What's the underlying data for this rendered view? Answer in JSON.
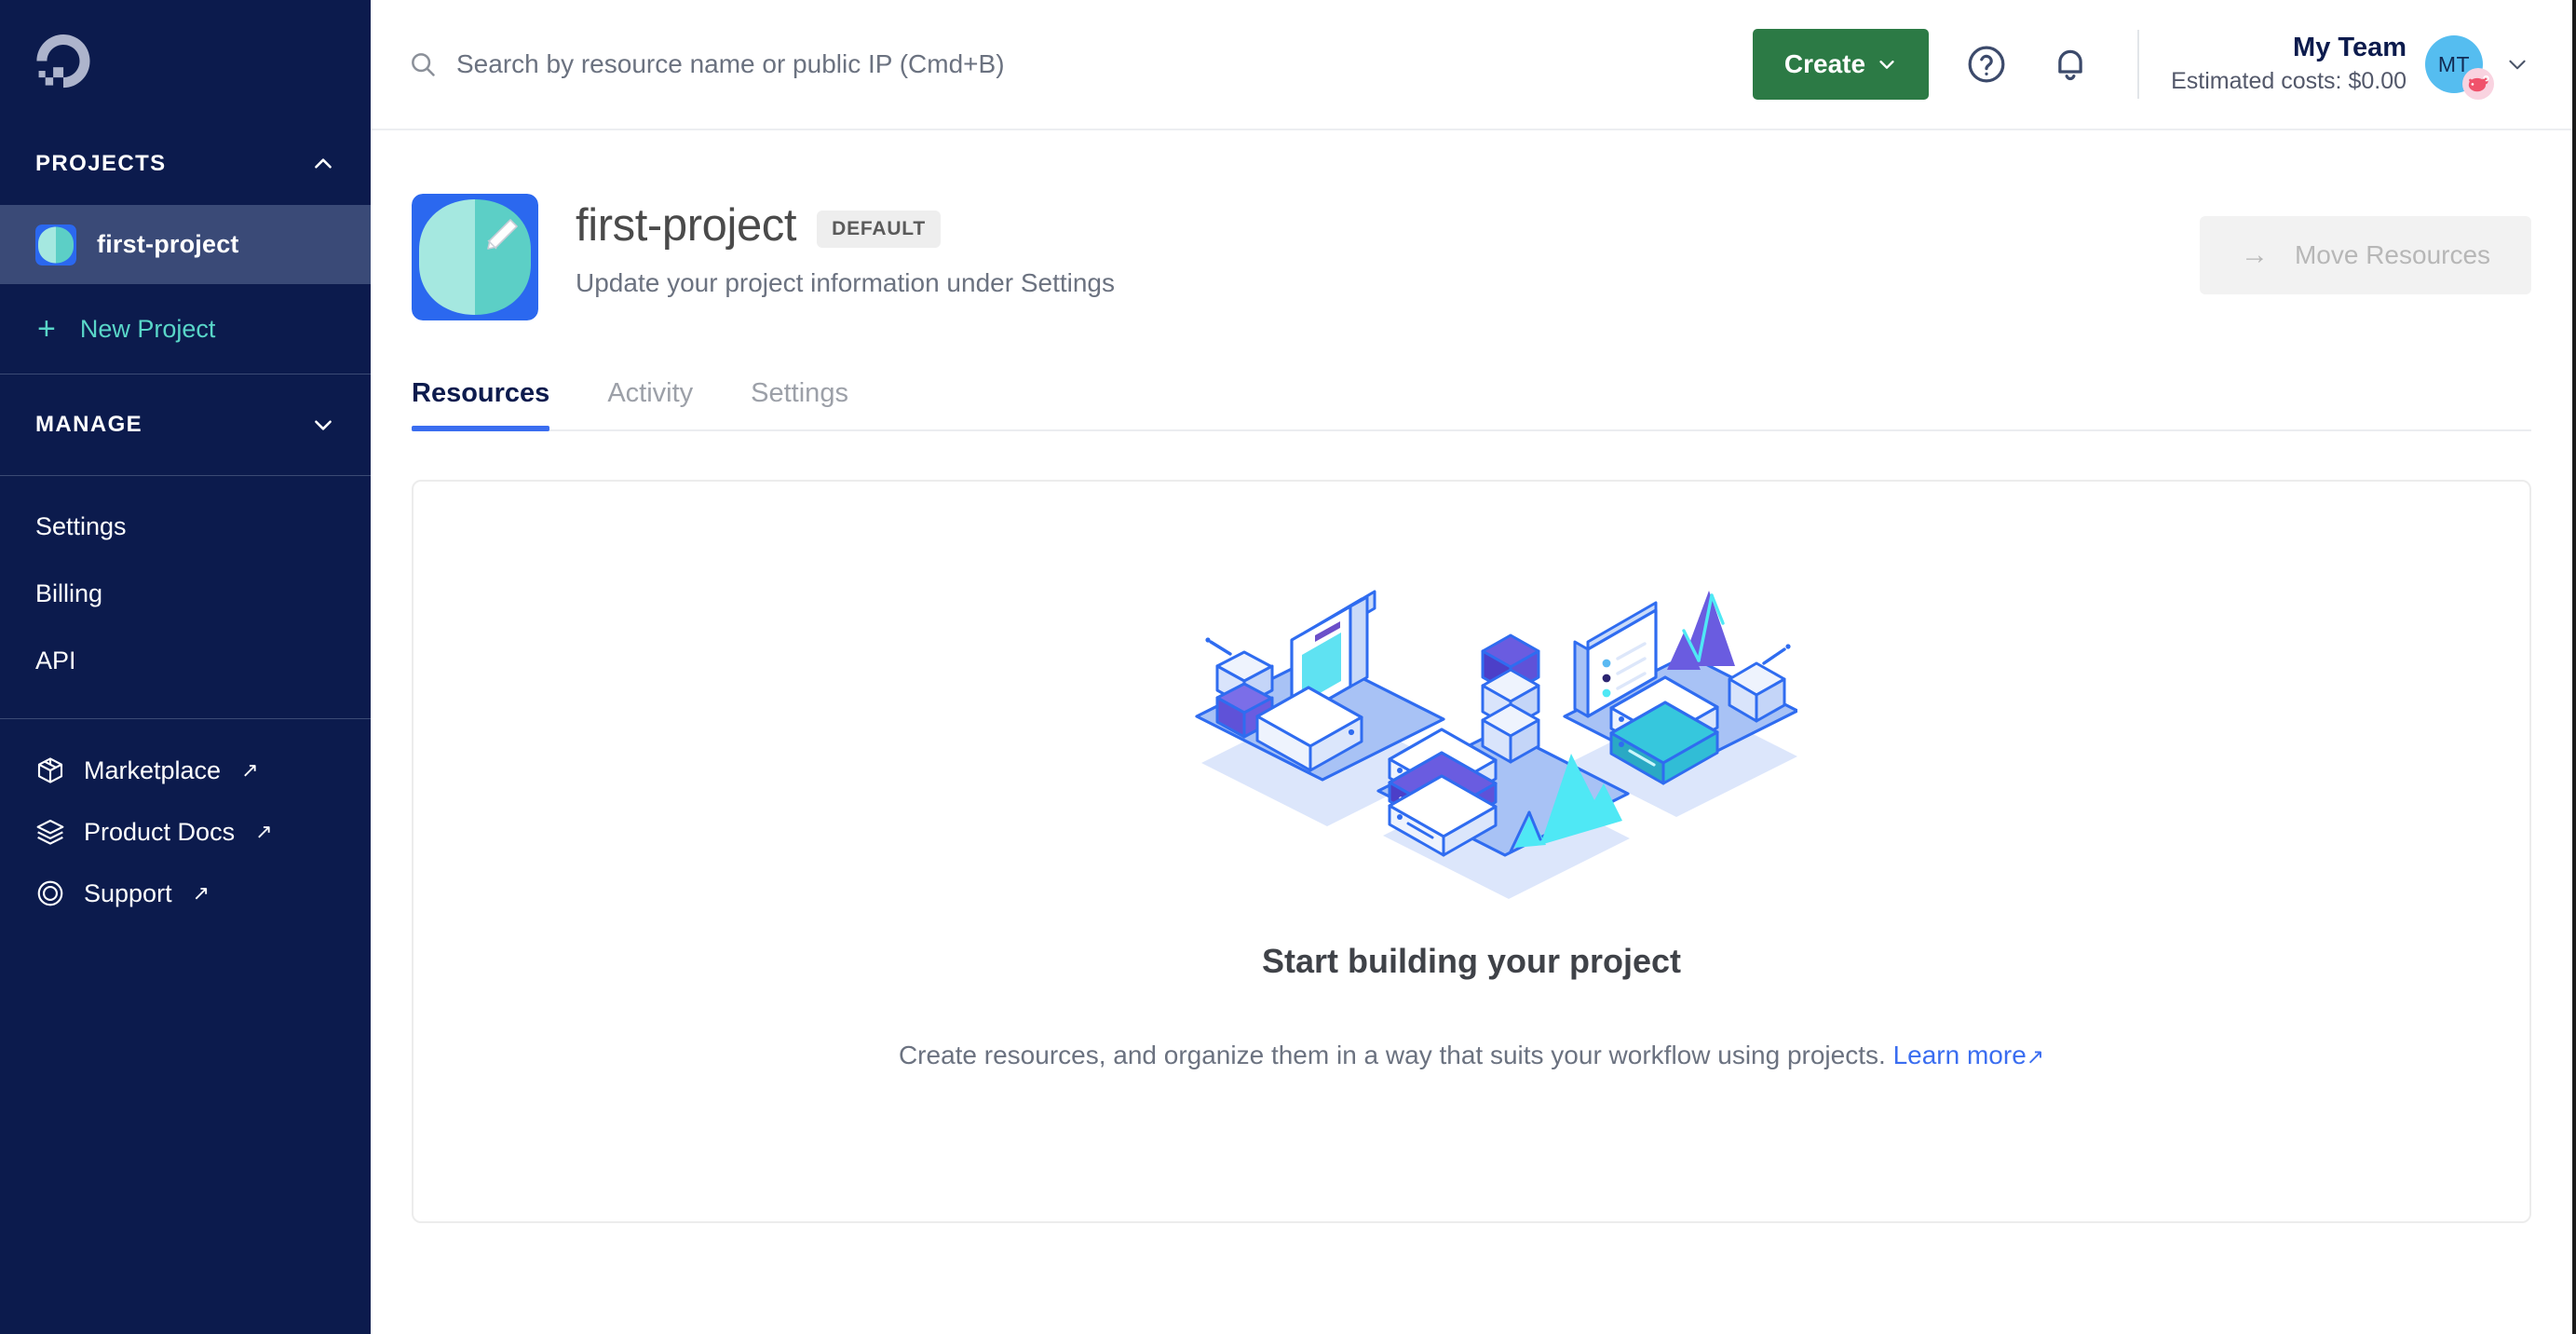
{
  "sidebar": {
    "logo_icon": "digitalocean-logo",
    "projects_section": {
      "label": "PROJECTS",
      "chevron_icon": "chevron-up-icon",
      "items": [
        {
          "label": "first-project",
          "icon": "project-avatar-icon",
          "active": true
        }
      ],
      "new_project": {
        "label": "New Project",
        "icon": "plus-icon"
      }
    },
    "manage_section": {
      "label": "MANAGE",
      "chevron_icon": "chevron-down-icon",
      "items": [
        {
          "label": "Settings"
        },
        {
          "label": "Billing"
        },
        {
          "label": "API"
        }
      ]
    },
    "external_links": [
      {
        "label": "Marketplace",
        "icon": "cube-icon",
        "external_icon": "↗"
      },
      {
        "label": "Product Docs",
        "icon": "layers-icon",
        "external_icon": "↗"
      },
      {
        "label": "Support",
        "icon": "lifering-icon",
        "external_icon": "↗"
      }
    ]
  },
  "topbar": {
    "search": {
      "icon": "search-icon",
      "placeholder": "Search by resource name or public IP (Cmd+B)",
      "value": ""
    },
    "create_button": {
      "label": "Create",
      "chevron_icon": "chevron-down-icon",
      "color": "#2c7a45"
    },
    "help_icon": "question-circle-icon",
    "notifications_icon": "bell-icon",
    "account": {
      "team_name": "My Team",
      "estimated_costs": "Estimated costs: $0.00",
      "avatar_initials": "MT",
      "avatar_color": "#55bdf0",
      "badge_icon": "piggy-bank-icon",
      "chevron_icon": "chevron-down-icon"
    }
  },
  "project": {
    "avatar_icon": "project-avatar-icon",
    "name": "first-project",
    "badge": "DEFAULT",
    "subtitle": "Update your project information under Settings",
    "move_resources_button": {
      "label": "Move Resources",
      "arrow_icon": "arrow-right-icon",
      "disabled": true
    },
    "tabs": [
      {
        "label": "Resources",
        "active": true
      },
      {
        "label": "Activity",
        "active": false
      },
      {
        "label": "Settings",
        "active": false
      }
    ],
    "active_tab_color": "#3a6df0"
  },
  "empty_state": {
    "illustration_icon": "isometric-cloud-resources-illustration",
    "title": "Start building your project",
    "description": "Create resources, and organize them in a way that suits your workflow using projects.",
    "link_label": "Learn more",
    "link_external_icon": "↗",
    "link_color": "#3a6df0"
  }
}
